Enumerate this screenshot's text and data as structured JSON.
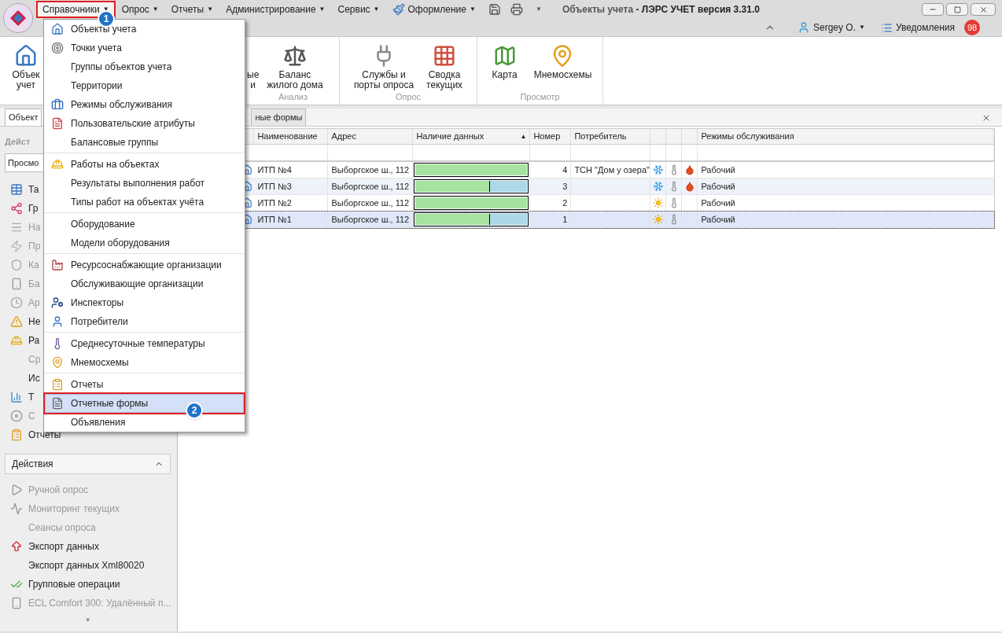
{
  "window": {
    "document_title": "Объекты учета",
    "app_title": "- ЛЭРС УЧЕТ версия 3.31.0"
  },
  "menubar": [
    {
      "label": "Справочники",
      "caret": "▼",
      "selected": true,
      "callout": "1",
      "kind": "plain"
    },
    {
      "label": "Опрос",
      "caret": "▼",
      "selected": false,
      "kind": "plain"
    },
    {
      "label": "Отчеты",
      "caret": "▼",
      "selected": false,
      "kind": "plain"
    },
    {
      "label": "Администрирование",
      "caret": "▼",
      "selected": false,
      "kind": "plain"
    },
    {
      "label": "Сервис",
      "caret": "▼",
      "selected": false,
      "kind": "plain"
    },
    {
      "label": "Оформление",
      "caret": "▼",
      "selected": false,
      "kind": "brush"
    }
  ],
  "quick_access_caret": "▼",
  "user": {
    "name": "Sergey O.",
    "caret": "▼",
    "notifications_label": "Уведомления",
    "notifications_count": "98"
  },
  "ribbon": [
    {
      "buttons": [
        {
          "lines": [
            "Объек",
            "учет"
          ],
          "kind": "house"
        }
      ]
    },
    {
      "label": "Анализ",
      "buttons": [
        {
          "lines": [
            "ые",
            "и"
          ],
          "kind": "plain"
        },
        {
          "lines": [
            "Баланс",
            "жилого дома"
          ],
          "kind": "scale"
        }
      ]
    },
    {
      "label": "Опрос",
      "buttons": [
        {
          "lines": [
            "Службы и",
            "порты опроса"
          ],
          "kind": "plug"
        },
        {
          "lines": [
            "Сводка",
            "текущих"
          ],
          "kind": "grid"
        }
      ]
    },
    {
      "label": "Просмотр",
      "buttons": [
        {
          "lines": [
            "Карта"
          ],
          "kind": "map"
        },
        {
          "lines": [
            "Мнемосхемы"
          ],
          "kind": "pin"
        }
      ]
    }
  ],
  "tabs": [
    {
      "label": "Объект",
      "selected": true
    },
    {
      "label": "ные формы",
      "selected": false
    }
  ],
  "left_panel": {
    "header": "Дейст",
    "view_select": "Просмо",
    "items": [
      {
        "label": "Та",
        "kind": "table",
        "disabled": false
      },
      {
        "label": "Гр",
        "kind": "graph",
        "disabled": false
      },
      {
        "label": "На",
        "kind": "lines",
        "disabled": true
      },
      {
        "label": "Пр",
        "kind": "bolt",
        "disabled": true
      },
      {
        "label": "Ка",
        "kind": "shield",
        "disabled": true
      },
      {
        "label": "Ба",
        "kind": "device",
        "disabled": true
      },
      {
        "label": "Ар",
        "kind": "clock",
        "disabled": true
      },
      {
        "label": "Не",
        "kind": "warning",
        "disabled": false
      },
      {
        "label": "Ра",
        "kind": "helmet",
        "disabled": false
      },
      {
        "label": "Ср",
        "kind": "plain",
        "disabled": true
      },
      {
        "label": "Ис",
        "kind": "plain",
        "disabled": false
      },
      {
        "label": "Т",
        "kind": "chart",
        "disabled": false
      },
      {
        "label": "С",
        "kind": "disc",
        "disabled": true
      },
      {
        "label": "Отчеты",
        "kind": "clipboard",
        "disabled": false
      }
    ],
    "actions_header": "Действия",
    "actions_expanded": true,
    "actions": [
      {
        "label": "Ручной опрос",
        "kind": "play",
        "disabled": true
      },
      {
        "label": "Мониторинг текущих",
        "kind": "monitor",
        "disabled": true
      },
      {
        "label": "Сеансы опроса",
        "kind": "plain",
        "disabled": true
      },
      {
        "label": "Экспорт данных",
        "kind": "upload",
        "disabled": false
      },
      {
        "label": "Экспорт данных Xml80020",
        "kind": "plain",
        "disabled": false
      },
      {
        "label": "Групповые операции",
        "kind": "check",
        "disabled": false
      },
      {
        "label": "ECL Comfort 300: Удалённый п...",
        "kind": "device",
        "disabled": true
      }
    ],
    "scroll_down": "▼"
  },
  "table": {
    "columns": [
      {
        "kind": "text",
        "label": "Наименование"
      },
      {
        "kind": "text",
        "label": "Адрес"
      },
      {
        "kind": "text",
        "label": "Наличие данных",
        "sort_indicator": "▲"
      },
      {
        "kind": "text",
        "label": "Номер"
      },
      {
        "kind": "text",
        "label": "Потребитель"
      },
      {
        "kind": "icon"
      },
      {
        "kind": "icon"
      },
      {
        "kind": "icon"
      },
      {
        "kind": "text",
        "label": "Режимы обслуживания"
      }
    ],
    "rows": [
      {
        "name": "ИТП №4",
        "address": "Выборгское ш., 112",
        "level": 1,
        "number": "4",
        "consumer": "ТСН \"Дом у озера\"",
        "icons": [
          {
            "kind": "snowflake"
          },
          {
            "kind": "thermometer"
          },
          {
            "kind": "tap"
          }
        ],
        "mode": "Рабочий",
        "selected": false
      },
      {
        "name": "ИТП №3",
        "address": "Выборгское ш., 112",
        "level": 0.66,
        "number": "3",
        "icons": [
          {
            "kind": "snowflake"
          },
          {
            "kind": "thermometer"
          },
          {
            "kind": "tap"
          }
        ],
        "mode": "Рабочий",
        "selected": false
      },
      {
        "name": "ИТП №2",
        "address": "Выборгское ш., 112",
        "level": 1,
        "number": "2",
        "icons": [
          {
            "kind": "sun"
          },
          {
            "kind": "thermometer"
          }
        ],
        "mode": "Рабочий",
        "selected": false
      },
      {
        "name": "ИТП №1",
        "address": "Выборгское ш., 112",
        "level": 0.66,
        "number": "1",
        "icons": [
          {
            "kind": "sun"
          },
          {
            "kind": "thermometer"
          }
        ],
        "mode": "Рабочий",
        "selected": true
      }
    ]
  },
  "dropdown_menu": {
    "groups": [
      [
        {
          "label": "Объекты учета",
          "kind": "house",
          "selected": false
        },
        {
          "label": "Точки учета",
          "kind": "point",
          "selected": false
        },
        {
          "label": "Группы объектов учета",
          "kind": "plain",
          "selected": false
        },
        {
          "label": "Территории",
          "kind": "plain",
          "selected": false
        },
        {
          "label": "Режимы обслуживания",
          "kind": "briefcase",
          "selected": false
        },
        {
          "label": "Пользовательские атрибуты",
          "kind": "attribute",
          "selected": false
        },
        {
          "label": "Балансовые группы",
          "kind": "plain",
          "selected": false
        }
      ],
      [
        {
          "label": "Работы на объектах",
          "kind": "helmet",
          "selected": false
        },
        {
          "label": "Результаты выполнения работ",
          "kind": "plain",
          "selected": false
        },
        {
          "label": "Типы работ на объектах учёта",
          "kind": "plain",
          "selected": false
        }
      ],
      [
        {
          "label": "Оборудование",
          "kind": "plain",
          "selected": false
        },
        {
          "label": "Модели оборудования",
          "kind": "plain",
          "selected": false
        }
      ],
      [
        {
          "label": "Ресурсоснабжающие организации",
          "kind": "factory",
          "selected": false
        },
        {
          "label": "Обслуживающие организации",
          "kind": "plain",
          "selected": false
        },
        {
          "label": "Инспекторы",
          "kind": "inspector",
          "selected": false
        },
        {
          "label": "Потребители",
          "kind": "person",
          "selected": false
        }
      ],
      [
        {
          "label": "Среднесуточные температуры",
          "kind": "thermo",
          "selected": false
        },
        {
          "label": "Мнемосхемы",
          "kind": "pin",
          "selected": false
        }
      ],
      [
        {
          "label": "Отчеты",
          "kind": "clipboard",
          "selected": false
        },
        {
          "label": "Отчетные формы",
          "kind": "doc",
          "selected": true,
          "callout": "2"
        },
        {
          "label": "Объявления",
          "kind": "plain",
          "selected": false
        }
      ]
    ]
  }
}
